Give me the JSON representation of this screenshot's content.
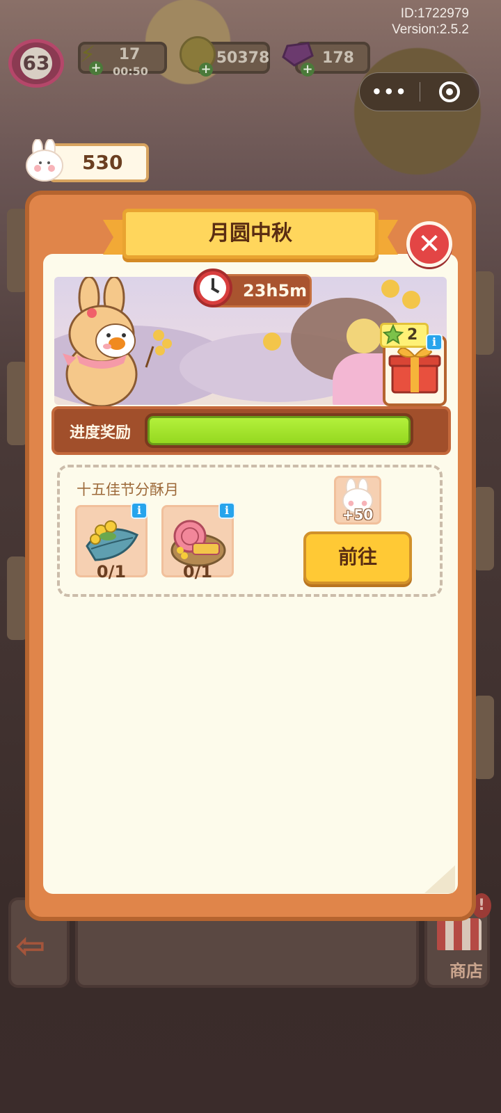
{
  "meta": {
    "id_line": "ID:1722979",
    "version_line": "Version:2.5.2"
  },
  "hud": {
    "level": "63",
    "energy": "17",
    "energy_timer": "00:50",
    "coins": "50378",
    "gems": "178",
    "bunny_tokens": "530",
    "capsule_more": "•••"
  },
  "modal": {
    "title": "月圆中秋",
    "close_symbol": "✕",
    "timer": "23h5m",
    "gift_stars": "2",
    "info_symbol": "i",
    "progress_label": "进度奖励",
    "progress_fraction": 1.0
  },
  "task": {
    "title": "十五佳节分酥月",
    "items": [
      {
        "count": "0/1",
        "icon": "osmanthus-leaf-icon"
      },
      {
        "count": "0/1",
        "icon": "mooncake-plate-icon"
      }
    ],
    "reward_amount": "+50",
    "go_label": "前往"
  },
  "background": {
    "shop_label": "商店",
    "alert_symbol": "!"
  },
  "colors": {
    "modal_frame": "#e0854a",
    "title_plaque": "#ffd65c",
    "progress_fill": "#a4e52e",
    "go_button": "#ffc935",
    "close_button": "#e34545"
  }
}
